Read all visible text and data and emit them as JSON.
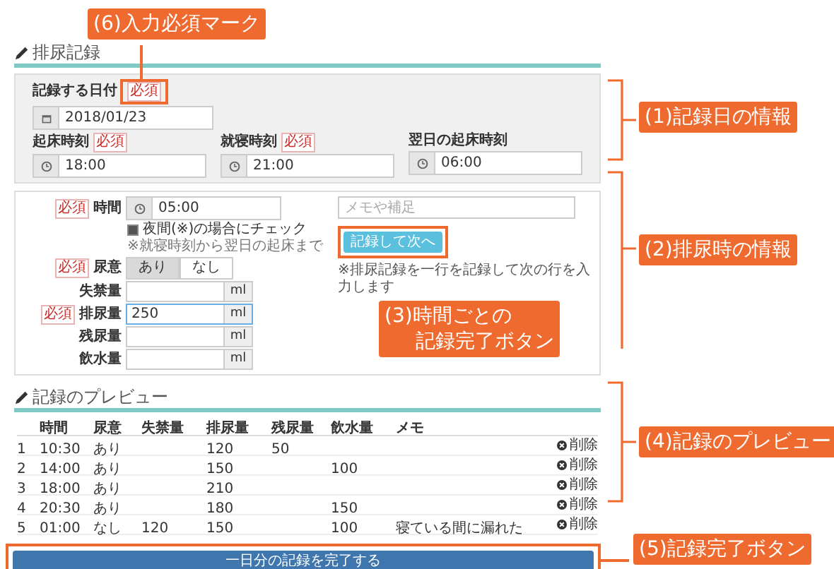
{
  "record_section": {
    "title": "排尿記録"
  },
  "day_info": {
    "date_field": {
      "label": "記録する日付",
      "required_mark": "必須",
      "value": "2018/01/23"
    },
    "times": [
      {
        "label": "起床時刻",
        "required_mark": "必須",
        "value": "18:00"
      },
      {
        "label": "就寝時刻",
        "required_mark": "必須",
        "value": "21:00"
      },
      {
        "label": "翌日の起床時刻",
        "value": "06:00"
      }
    ]
  },
  "entry_form": {
    "time": {
      "required_mark": "必須",
      "label": "時間",
      "value": "05:00"
    },
    "night_check": {
      "label": "夜間(※)の場合にチェック",
      "checked": true,
      "note": "※就寝時刻から翌日の起床まで"
    },
    "urge": {
      "required_mark": "必須",
      "label": "尿意",
      "options": [
        {
          "label": "あり",
          "selected": true
        },
        {
          "label": "なし",
          "selected": false
        }
      ]
    },
    "amounts": [
      {
        "label": "失禁量",
        "focused": false,
        "unit": "ml"
      },
      {
        "label": "排尿量",
        "required_mark": "必須",
        "value": "250",
        "focused": true,
        "unit": "ml"
      },
      {
        "label": "残尿量",
        "focused": false,
        "unit": "ml"
      },
      {
        "label": "飲水量",
        "focused": false,
        "unit": "ml"
      }
    ],
    "memo": {
      "placeholder": "メモや補足"
    },
    "next_button": "記録して次へ",
    "next_note": "※排尿記録を一行を記録して次の行を入力します"
  },
  "preview": {
    "title": "記録のプレビュー",
    "columns": [
      "時間",
      "尿意",
      "失禁量",
      "排尿量",
      "残尿量",
      "飲水量",
      "メモ"
    ],
    "rows": [
      {
        "no": "1",
        "cells": [
          "10:30",
          "あり",
          "",
          "120",
          "50",
          "",
          ""
        ],
        "action": "削除"
      },
      {
        "no": "2",
        "cells": [
          "14:00",
          "あり",
          "",
          "150",
          "",
          "100",
          ""
        ],
        "action": "削除"
      },
      {
        "no": "3",
        "cells": [
          "18:00",
          "あり",
          "",
          "210",
          "",
          "",
          ""
        ],
        "action": "削除"
      },
      {
        "no": "4",
        "cells": [
          "20:30",
          "あり",
          "",
          "180",
          "",
          "150",
          ""
        ],
        "action": "削除"
      },
      {
        "no": "5",
        "cells": [
          "01:00",
          "なし",
          "120",
          "150",
          "",
          "100",
          "寝ている間に漏れた"
        ],
        "action": "削除"
      }
    ]
  },
  "complete_button": "一日分の記録を完了する",
  "annotations": [
    {
      "lines": [
        "(6)入力必須マーク"
      ]
    },
    {
      "lines": [
        "(1)記録日の情報"
      ]
    },
    {
      "lines": [
        "(2)排尿時の情報"
      ]
    },
    {
      "lines": [
        "(3)時間ごとの",
        "記録完了ボタン"
      ]
    },
    {
      "lines": [
        "(4)記録のプレビュー"
      ]
    },
    {
      "lines": [
        "(5)記録完了ボタン"
      ]
    }
  ]
}
